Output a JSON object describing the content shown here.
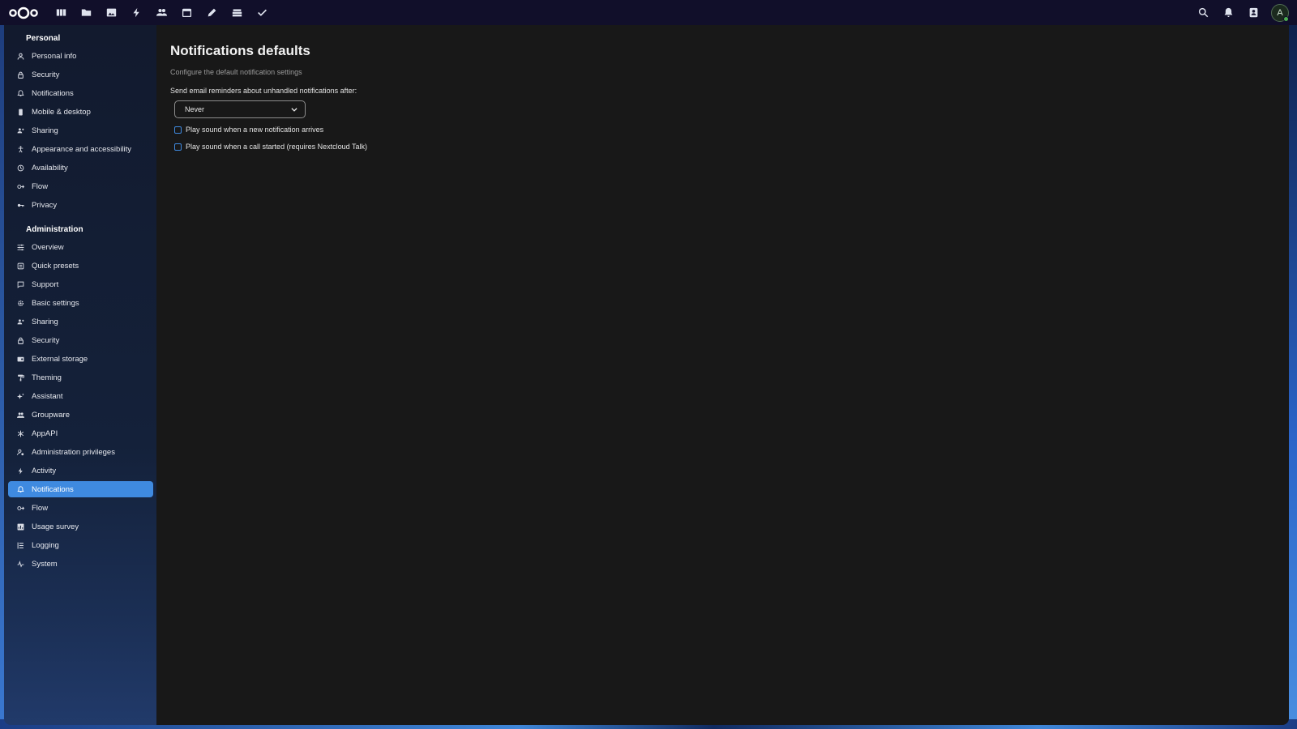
{
  "header": {
    "apps": [
      {
        "name": "dashboard-icon"
      },
      {
        "name": "files-icon"
      },
      {
        "name": "photos-icon"
      },
      {
        "name": "activity-icon"
      },
      {
        "name": "contacts-icon"
      },
      {
        "name": "calendar-icon"
      },
      {
        "name": "notes-icon"
      },
      {
        "name": "deck-icon"
      },
      {
        "name": "tasks-icon"
      }
    ],
    "right_icons": [
      "search-icon",
      "notifications-bell-icon",
      "contacts-menu-icon"
    ],
    "avatar_letter": "A"
  },
  "sidebar": {
    "personal_caption": "Personal",
    "personal_items": [
      {
        "label": "Personal info"
      },
      {
        "label": "Security"
      },
      {
        "label": "Notifications"
      },
      {
        "label": "Mobile & desktop"
      },
      {
        "label": "Sharing"
      },
      {
        "label": "Appearance and accessibility"
      },
      {
        "label": "Availability"
      },
      {
        "label": "Flow"
      },
      {
        "label": "Privacy"
      }
    ],
    "admin_caption": "Administration",
    "admin_items": [
      {
        "label": "Overview"
      },
      {
        "label": "Quick presets"
      },
      {
        "label": "Support"
      },
      {
        "label": "Basic settings"
      },
      {
        "label": "Sharing"
      },
      {
        "label": "Security"
      },
      {
        "label": "External storage"
      },
      {
        "label": "Theming"
      },
      {
        "label": "Assistant"
      },
      {
        "label": "Groupware"
      },
      {
        "label": "AppAPI"
      },
      {
        "label": "Administration privileges"
      },
      {
        "label": "Activity"
      },
      {
        "label": "Notifications"
      },
      {
        "label": "Flow"
      },
      {
        "label": "Usage survey"
      },
      {
        "label": "Logging"
      },
      {
        "label": "System"
      }
    ]
  },
  "main": {
    "title": "Notifications defaults",
    "subtitle": "Configure the default notification settings",
    "email_label": "Send email reminders about unhandled notifications after:",
    "email_select_value": "Never",
    "checkbox_sound_notification": "Play sound when a new notification arrives",
    "checkbox_sound_call": "Play sound when a call started (requires Nextcloud Talk)"
  },
  "colors": {
    "accent": "#3f8ae0",
    "header_bg": "#110f2a",
    "content_bg": "#181818"
  }
}
